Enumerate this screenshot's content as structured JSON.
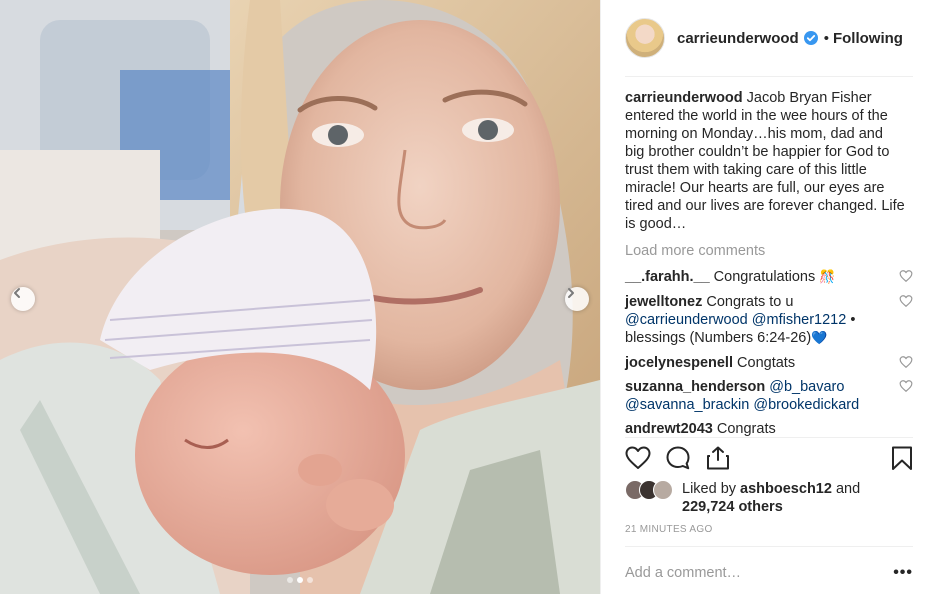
{
  "photo": {
    "prev_icon": "chevron-left-icon",
    "next_icon": "chevron-right-icon",
    "slide_count": 3,
    "active_slide": 2
  },
  "post": {
    "author": "carrieunderwood",
    "verified_icon": "verified-badge-icon",
    "separator": "•",
    "follow_status": "Following",
    "caption_user": "carrieunderwood",
    "caption_text": "Jacob Bryan Fisher entered the world in the wee hours of the morning on Monday…his mom, dad and big brother couldn’t be happier for God to trust them with taking care of this little miracle! Our hearts are full, our eyes are tired and our lives are forever changed. Life is good…",
    "load_more": "Load more comments",
    "comments": [
      {
        "user": "__.farahh.__",
        "text": "Congratulations",
        "emoji": "🎊"
      },
      {
        "user": "jewelltonez",
        "text_before": "Congrats to u",
        "mention1": "@carrieunderwood",
        "mention2": "@mfisher1212",
        "text_after": "• blessings (Numbers 6:24-26)",
        "emoji": "💙"
      },
      {
        "user": "jocelynespenell",
        "text": "Congtats"
      },
      {
        "user": "suzanna_henderson",
        "mention1": "@b_bavaro",
        "mention2": "@savanna_brackin",
        "mention3": "@brookedickard"
      },
      {
        "user": "andrewt2043",
        "text": "Congrats"
      }
    ],
    "likes_prefix": "Liked by",
    "likes_user": "ashboesch12",
    "likes_and": "and",
    "likes_others": "229,724 others",
    "timestamp": "21 minutes ago",
    "comment_placeholder": "Add a comment…",
    "more_label": "•••"
  },
  "colors": {
    "verified": "#3897f0",
    "link": "#003569",
    "muted": "#999999"
  }
}
